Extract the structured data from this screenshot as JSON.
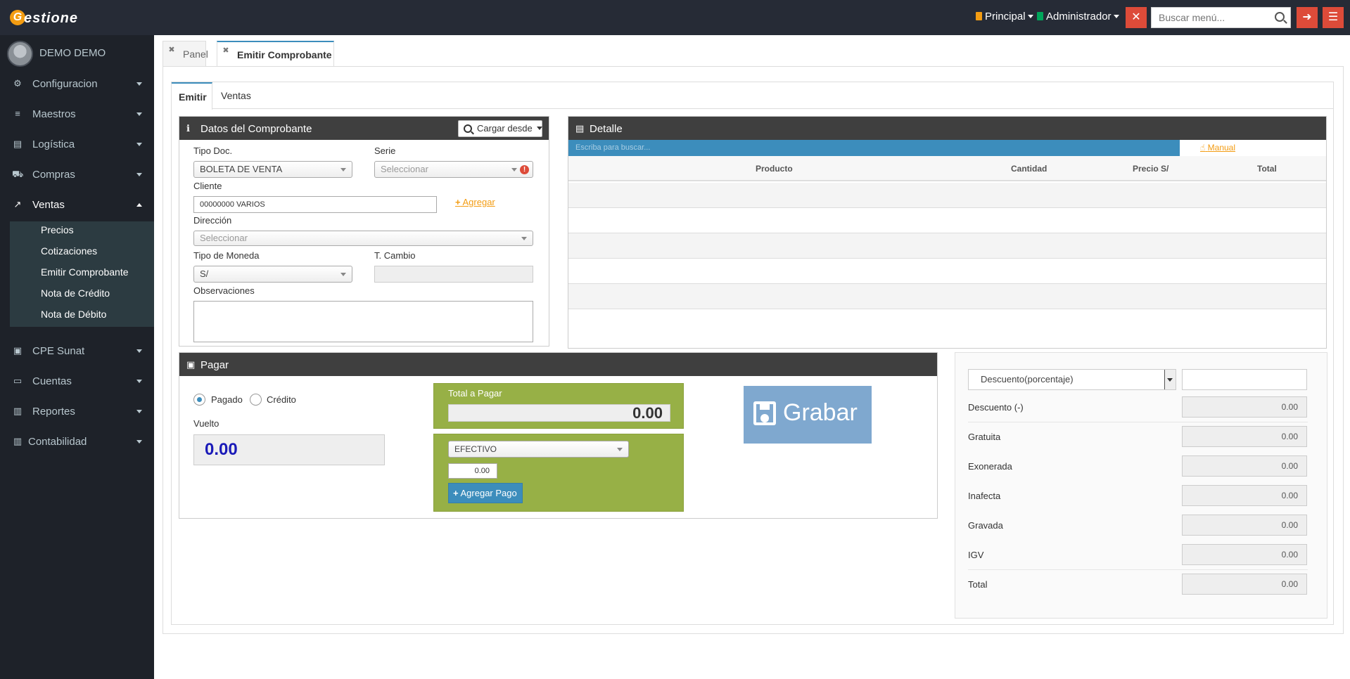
{
  "app": {
    "logo_letter": "G",
    "logo_text": "estione"
  },
  "topbar": {
    "principal": "Principal",
    "admin": "Administrador",
    "search_placeholder": "Buscar menú...",
    "accent": "#dd4b39"
  },
  "sidebar": {
    "user_name": "DEMO DEMO",
    "items": [
      {
        "label": "Configuracion",
        "icon": "gears-icon"
      },
      {
        "label": "Maestros",
        "icon": "list-icon"
      },
      {
        "label": "Logística",
        "icon": "building-icon"
      },
      {
        "label": "Compras",
        "icon": "cart-icon"
      },
      {
        "label": "Ventas",
        "icon": "line-chart-icon"
      },
      {
        "label": "CPE Sunat",
        "icon": "document-icon"
      },
      {
        "label": "Cuentas",
        "icon": "cc-icon"
      },
      {
        "label": "Reportes",
        "icon": "book-icon"
      },
      {
        "label": "Contabilidad",
        "icon": "book-icon"
      }
    ],
    "submenu": [
      "Precios",
      "Cotizaciones",
      "Emitir Comprobante",
      "Nota de Crédito",
      "Nota de Débito"
    ]
  },
  "page_tabs": {
    "panel": "Panel",
    "emitir": "Emitir Comprobante"
  },
  "sub_tabs": {
    "emitir": "Emitir",
    "ventas": "Ventas"
  },
  "datos": {
    "title": "Datos del Comprobante",
    "cargar": "Cargar desde",
    "tipo_doc_label": "Tipo Doc.",
    "tipo_doc_value": "BOLETA DE VENTA",
    "serie_label": "Serie",
    "serie_placeholder": "Seleccionar",
    "cliente_label": "Cliente",
    "cliente_value": "00000000 VARIOS",
    "agregar": "Agregar",
    "direccion_label": "Dirección",
    "direccion_placeholder": "Seleccionar",
    "moneda_label": "Tipo de Moneda",
    "moneda_value": "S/",
    "cambio_label": "T. Cambio",
    "obs_label": "Observaciones"
  },
  "detalle": {
    "title": "Detalle",
    "search_placeholder": "Escriba para buscar...",
    "manual": "Manual",
    "columns": [
      "Producto",
      "Cantidad",
      "Precio S/",
      "Total"
    ]
  },
  "pagar": {
    "title": "Pagar",
    "pagado": "Pagado",
    "credito": "Crédito",
    "vuelto_label": "Vuelto",
    "vuelto_value": "0.00",
    "total_label": "Total a Pagar",
    "total_value": "0.00",
    "metodo": "EFECTIVO",
    "monto": "0.00",
    "agregar_pago": "Agregar Pago",
    "grabar": "Grabar"
  },
  "totales": {
    "descuento_tipo": "Descuento(porcentaje)",
    "rows": [
      {
        "label": "Descuento (-)",
        "value": "0.00"
      },
      {
        "label": "Gratuita",
        "value": "0.00"
      },
      {
        "label": "Exonerada",
        "value": "0.00"
      },
      {
        "label": "Inafecta",
        "value": "0.00"
      },
      {
        "label": "Gravada",
        "value": "0.00"
      },
      {
        "label": "IGV",
        "value": "0.00"
      },
      {
        "label": "Total",
        "value": "0.00"
      }
    ]
  }
}
